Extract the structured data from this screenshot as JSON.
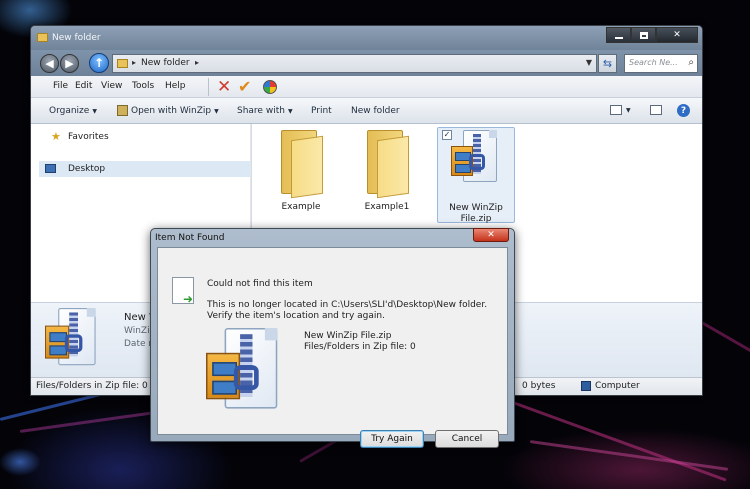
{
  "window": {
    "title": "New folder",
    "address_path": "New folder",
    "search_placeholder": "Search Ne..."
  },
  "menu": [
    "File",
    "Edit",
    "View",
    "Tools",
    "Help"
  ],
  "commands": {
    "organize": "Organize",
    "open_winzip": "Open with WinZip",
    "share_with": "Share with",
    "print": "Print",
    "new_folder": "New folder"
  },
  "nav": {
    "favorites": "Favorites",
    "desktop": "Desktop"
  },
  "files": [
    {
      "name": "Example"
    },
    {
      "name": "Example1"
    },
    {
      "name_line1": "New WinZip",
      "name_line2": "File.zip"
    }
  ],
  "details": {
    "name": "New Wi",
    "type": "WinZip",
    "date": "Date m"
  },
  "status": {
    "left": "Files/Folders in Zip file: 0",
    "size": "0 bytes",
    "computer": "Computer"
  },
  "dialog": {
    "title": "Item Not Found",
    "heading": "Could not find this item",
    "message": "This is no longer located in C:\\Users\\SLI'd\\Desktop\\New folder. Verify the item's location and try again.",
    "item_name": "New WinZip File.zip",
    "item_info": "Files/Folders in Zip file: 0",
    "try_again": "Try Again",
    "cancel": "Cancel"
  },
  "icons": [
    "back-icon",
    "forward-icon",
    "up-icon",
    "refresh-icon",
    "search-icon",
    "delete-icon",
    "checkmark-icon",
    "color-wheel-icon",
    "star-icon",
    "desktop-icon",
    "help-icon",
    "computer-icon"
  ],
  "colors": {
    "accent": "#2f6cc5",
    "close_red": "#c4321b"
  }
}
